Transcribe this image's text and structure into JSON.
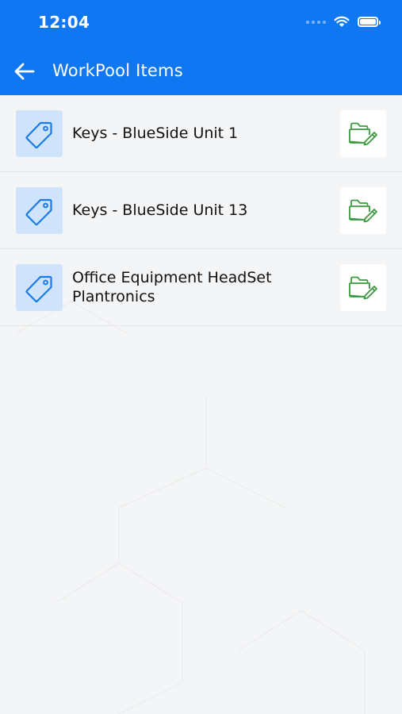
{
  "status_bar": {
    "time": "12:04",
    "icons": [
      "signal-dots-icon",
      "wifi-icon",
      "battery-icon"
    ]
  },
  "header": {
    "title": "WorkPool Items",
    "back_icon": "arrow-left-icon"
  },
  "items": [
    {
      "label": "Keys - BlueSide Unit 1",
      "icon": "tag-icon",
      "action_icon": "folder-edit-icon"
    },
    {
      "label": "Keys - BlueSide Unit 13",
      "icon": "tag-icon",
      "action_icon": "folder-edit-icon"
    },
    {
      "label": "Office Equipment HeadSet Plantronics",
      "icon": "tag-icon",
      "action_icon": "folder-edit-icon"
    }
  ],
  "colors": {
    "primary": "#0f77f1",
    "tag_bg": "#cfe3fb",
    "tag_icon": "#1b7ae6",
    "edit_icon": "#3a9a3e",
    "background": "#f4f5f6",
    "divider": "#e3e5e7"
  }
}
